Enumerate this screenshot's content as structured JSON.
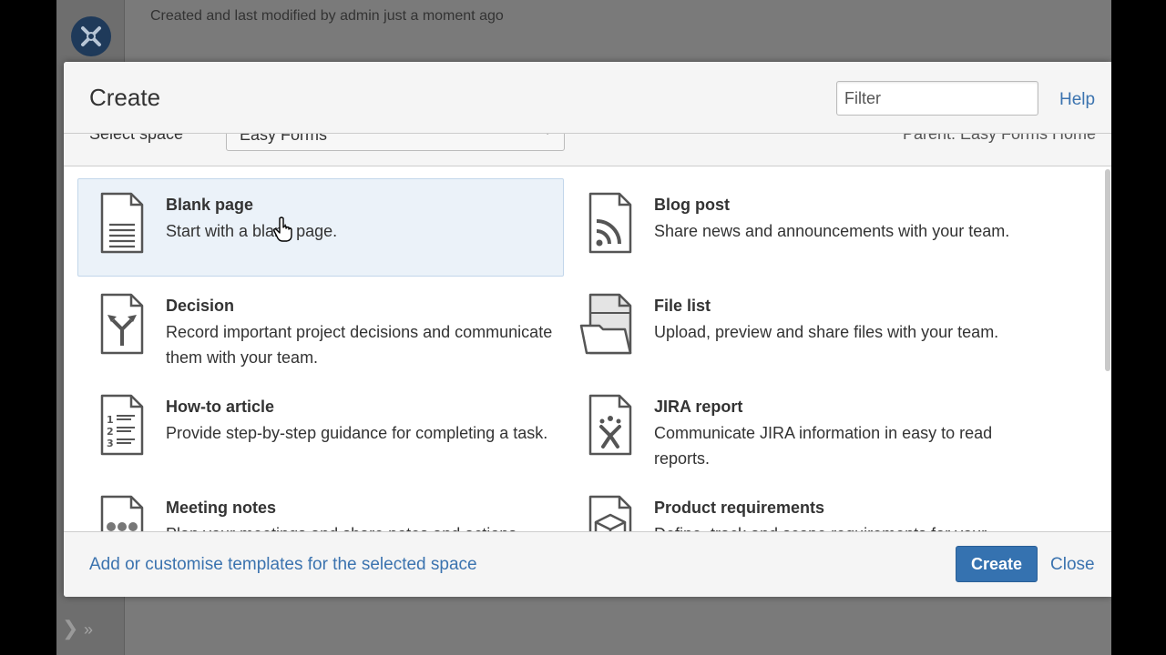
{
  "backdrop": {
    "meta_text": "Created and last modified by admin just a moment ago"
  },
  "dialog": {
    "title": "Create",
    "filter_placeholder": "Filter",
    "help_label": "Help",
    "space": {
      "label": "Select space",
      "selected": "Easy Forms",
      "parent": "Parent: Easy Forms Home"
    },
    "templates": [
      {
        "name": "Blank page",
        "description": "Start with a blank page.",
        "icon": "blank-page-icon",
        "selected": true
      },
      {
        "name": "Blog post",
        "description": "Share news and announcements with your team.",
        "icon": "rss-icon"
      },
      {
        "name": "Decision",
        "description": "Record important project decisions and communicate them with your team.",
        "icon": "decision-icon"
      },
      {
        "name": "File list",
        "description": "Upload, preview and share files with your team.",
        "icon": "folder-icon"
      },
      {
        "name": "How-to article",
        "description": "Provide step-by-step guidance for completing a task.",
        "icon": "numbered-list-icon"
      },
      {
        "name": "JIRA report",
        "description": "Communicate JIRA information in easy to read reports.",
        "icon": "jira-icon"
      },
      {
        "name": "Meeting notes",
        "description": "Plan your meetings and share notes and actions",
        "icon": "meeting-notes-icon"
      },
      {
        "name": "Product requirements",
        "description": "Define, track and scope requirements for your",
        "icon": "product-box-icon"
      }
    ],
    "footer": {
      "templates_link": "Add or customise templates for the selected space",
      "create_label": "Create",
      "close_label": "Close"
    }
  },
  "colors": {
    "link": "#3b73af",
    "primary_button": "#3572b0",
    "selected_row": "#ebf2f9"
  }
}
